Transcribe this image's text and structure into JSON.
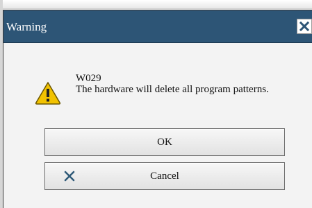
{
  "dialog": {
    "title": "Warning",
    "code": "W029",
    "message": "The hardware will delete all program patterns.",
    "icons": {
      "warning": "warning-triangle-icon",
      "close": "close-icon",
      "cancel": "x-icon"
    },
    "buttons": {
      "ok_label": "OK",
      "cancel_label": "Cancel"
    }
  },
  "colors": {
    "titlebar": "#2d5576",
    "warning_yellow": "#f2c200",
    "cancel_x": "#2f5a78"
  }
}
